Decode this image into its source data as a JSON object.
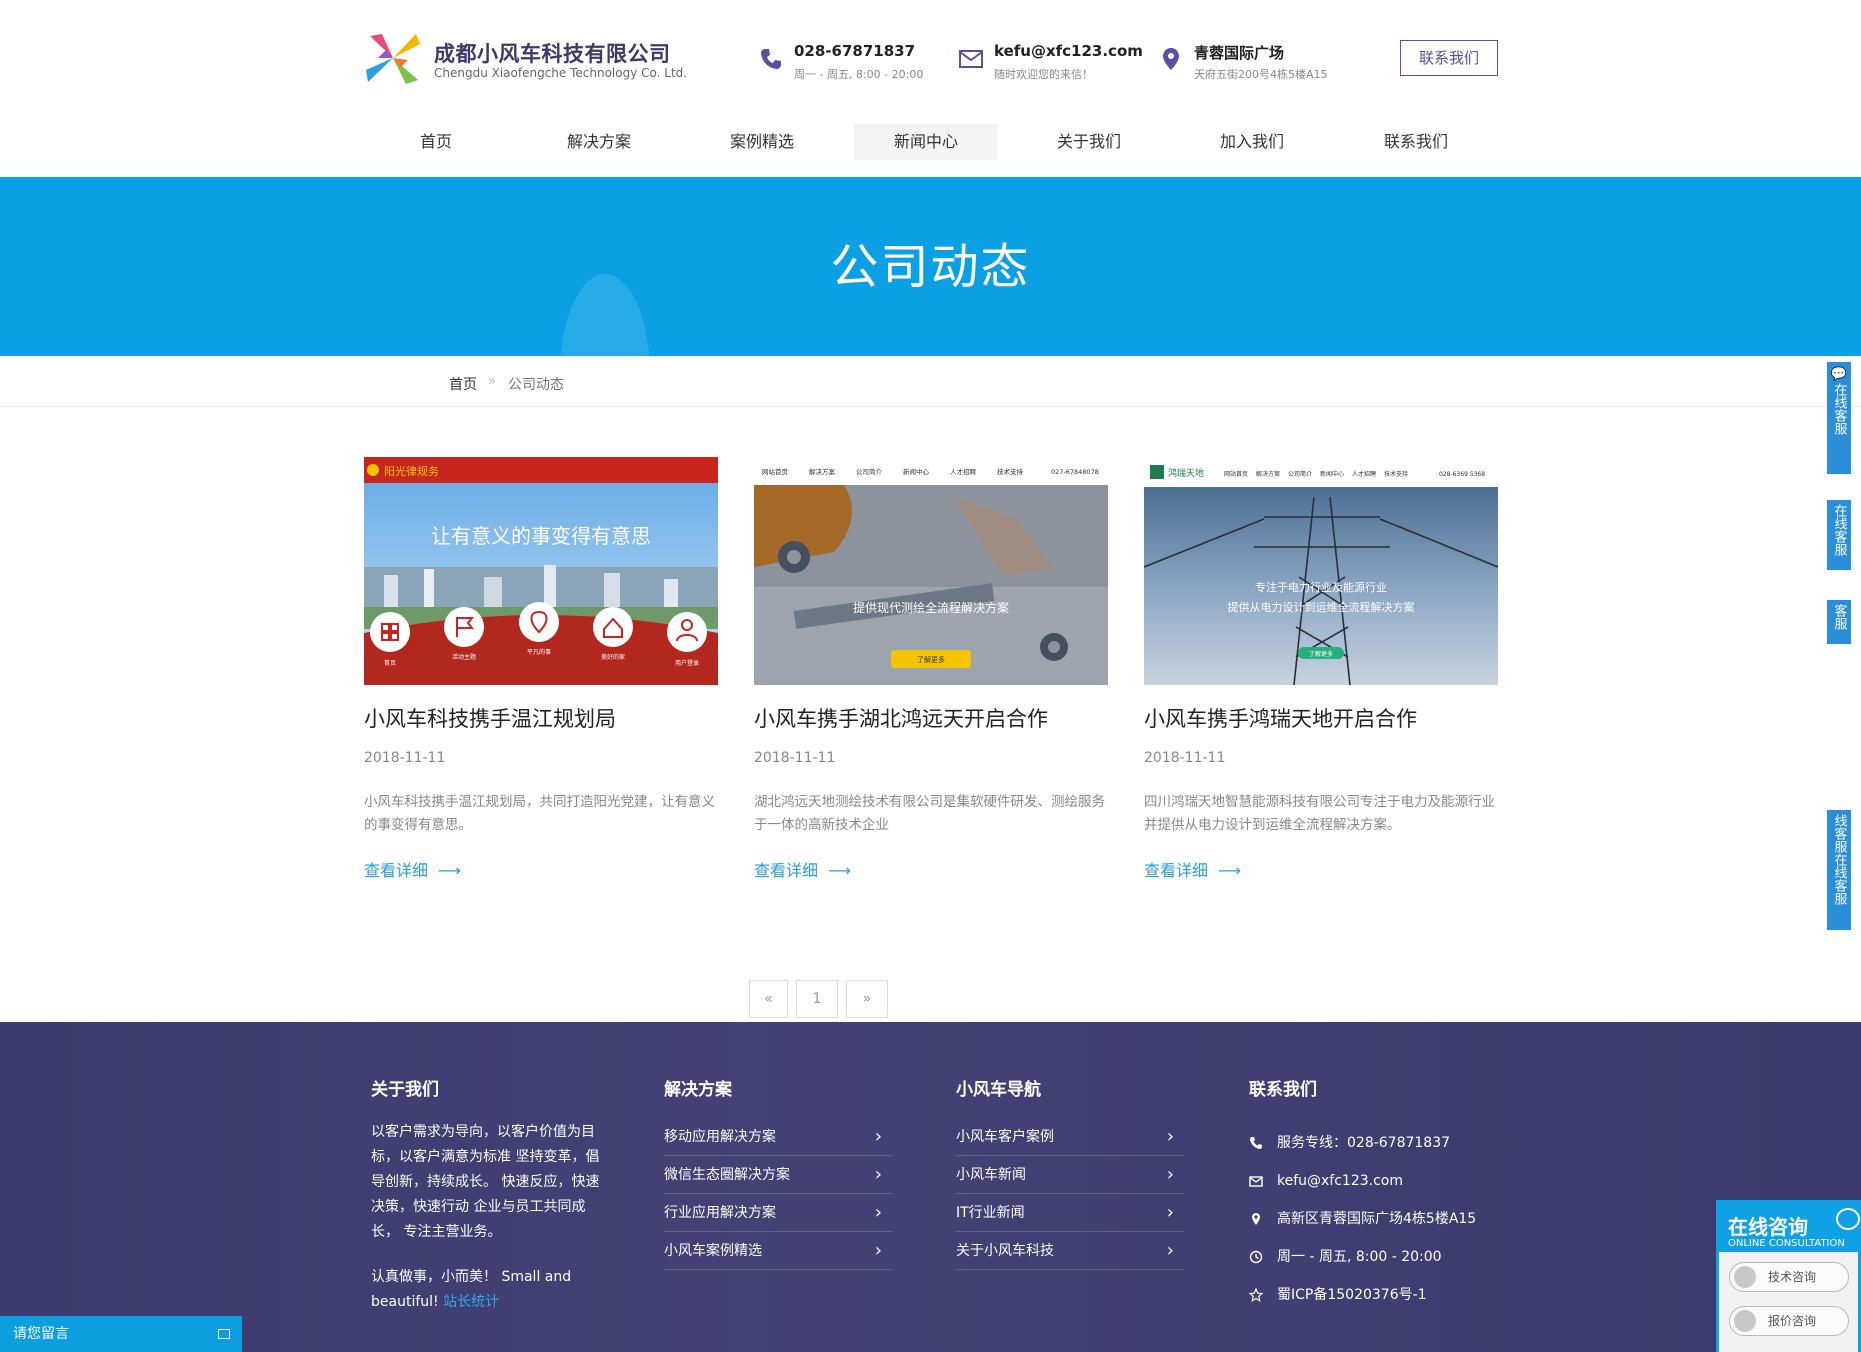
{
  "header": {
    "logo_cn": "成都小风车科技有限公司",
    "logo_en": "Chengdu Xiaofengche Technology Co. Ltd.",
    "phone": {
      "title": "028-67871837",
      "sub": "周一 - 周五, 8:00 - 20:00"
    },
    "mail": {
      "title": "kefu@xfc123.com",
      "sub": "随时欢迎您的来信！"
    },
    "addr": {
      "title": "青蓉国际广场",
      "sub": "天府五街200号4栋5楼A15"
    },
    "contact_button": "联系我们"
  },
  "nav": {
    "items": [
      {
        "label": "首页"
      },
      {
        "label": "解决方案"
      },
      {
        "label": "案例精选"
      },
      {
        "label": "新闻中心",
        "active": true
      },
      {
        "label": "关于我们"
      },
      {
        "label": "加入我们"
      },
      {
        "label": "联系我们"
      }
    ]
  },
  "banner": {
    "title": "公司动态"
  },
  "breadcrumb": {
    "home": "首页",
    "separator": "»",
    "current": "公司动态"
  },
  "cards": [
    {
      "title": "小风车科技携手温江规划局",
      "date": "2018-11-11",
      "desc": "小风车科技携手温江规划局，共同打造阳光党建，让有意义的事变得有意思。",
      "more": "查看详细",
      "thumb": {
        "brand": "阳光律规务",
        "slogan": "让有意义的事变得有意思",
        "icons": [
          "首页",
          "活动主题",
          "平凡的事",
          "美好的家",
          "用户登录"
        ]
      }
    },
    {
      "title": "小风车携手湖北鸿远天开启合作",
      "date": "2018-11-11",
      "desc": "湖北鸿远天地测绘技术有限公司是集软硬件研发、测绘服务于一体的高新技术企业",
      "more": "查看详细",
      "thumb": {
        "menu": [
          "网站首页",
          "解决方案",
          "公司简介",
          "新闻中心",
          "人才招聘",
          "技术支持"
        ],
        "phone": "027-67848078",
        "caption": "提供现代测绘全流程解决方案",
        "button": "了解更多"
      }
    },
    {
      "title": "小风车携手鸿瑞天地开启合作",
      "date": "2018-11-11",
      "desc": "四川鸿瑞天地智慧能源科技有限公司专注于电力及能源行业并提供从电力设计到运维全流程解决方案。",
      "more": "查看详细",
      "thumb": {
        "brand": "鸿瑞天地",
        "menu": [
          "网站首页",
          "解决方案",
          "公司简介",
          "新闻中心",
          "人才招聘",
          "技术支持"
        ],
        "phone": "028-6369 5368",
        "caption1": "专注于电力行业及能源行业",
        "caption2": "提供从电力设计到运维全流程解决方案",
        "button": "了解更多"
      }
    }
  ],
  "pagination": {
    "prev": "«",
    "current": "1",
    "next": "»"
  },
  "footer": {
    "about": {
      "heading": "关于我们",
      "text": "以客户需求为导向，以客户价值为目标，以客户满意为标准 坚持变革，倡导创新，持续成长。 快速反应，快速决策，快速行动 企业与员工共同成长， 专注主营业务。",
      "motto": "认真做事，小而美！ Small and beautiful!",
      "stat_link": "站长统计"
    },
    "solutions": {
      "heading": "解决方案",
      "items": [
        "移动应用解决方案",
        "微信生态圈解决方案",
        "行业应用解决方案",
        "小风车案例精选"
      ]
    },
    "navigation": {
      "heading": "小风车导航",
      "items": [
        "小风车客户案例",
        "小风车新闻",
        "IT行业新闻",
        "关于小风车科技"
      ]
    },
    "contact": {
      "heading": "联系我们",
      "rows": [
        {
          "icon": "phone-icon",
          "text": "服务专线：028-67871837"
        },
        {
          "icon": "mail-icon",
          "text": "kefu@xfc123.com"
        },
        {
          "icon": "location-icon",
          "text": "高新区青蓉国际广场4栋5楼A15"
        },
        {
          "icon": "clock-icon",
          "text": "周一 - 周五, 8:00 - 20:00"
        },
        {
          "icon": "star-icon",
          "text": "蜀ICP备15020376号-1"
        }
      ]
    }
  },
  "side_tabs": [
    {
      "text": "在线客服"
    },
    {
      "text": "在线客服"
    },
    {
      "text": "客服"
    },
    {
      "text": "线客服在线客服"
    }
  ],
  "message_box": {
    "label": "请您留言"
  },
  "consult": {
    "title": "在线咨询",
    "subtitle": "ONLINE CONSULTATION",
    "buttons": [
      "技术咨询",
      "报价咨询"
    ]
  },
  "colors": {
    "banner": "#0aa0e3",
    "footer": "#3b3a6b",
    "link": "#2a9fd6",
    "brand_purple": "#5a4fa0"
  }
}
